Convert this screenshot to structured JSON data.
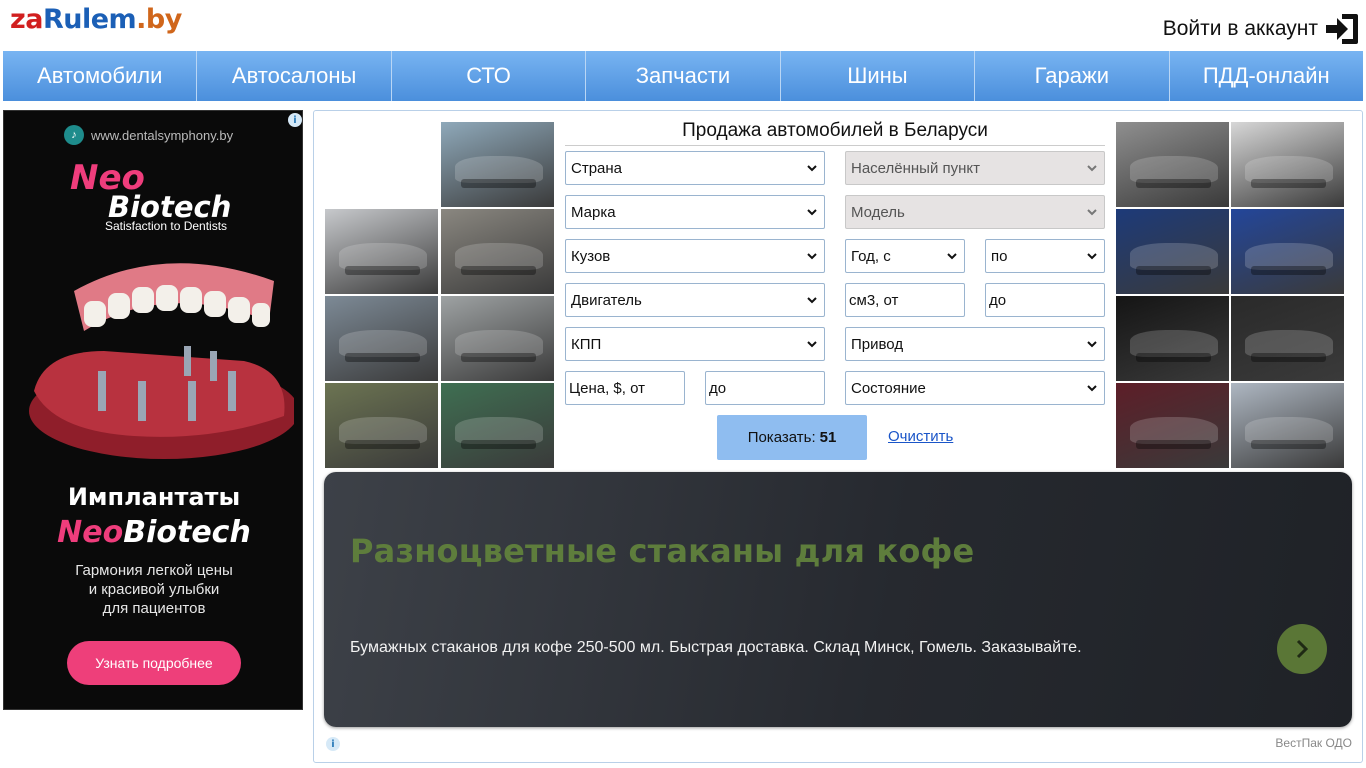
{
  "header": {
    "logo_part1": "za",
    "logo_part2": "Rulem",
    "logo_part3": ".by",
    "login_label": "Войти в аккаунт",
    "login_icon": "sign-in-icon"
  },
  "nav": {
    "items": [
      {
        "label": "Автомобили"
      },
      {
        "label": "Автосалоны"
      },
      {
        "label": "СТО"
      },
      {
        "label": "Запчасти"
      },
      {
        "label": "Шины"
      },
      {
        "label": "Гаражи"
      },
      {
        "label": "ПДД-онлайн"
      }
    ]
  },
  "left_ad": {
    "site": "www.dentalsymphony.by",
    "brand_neo": "Neo",
    "brand_biotech": "Biotech",
    "tagline": "Satisfaction to Dentists",
    "headline": "Имплантаты",
    "headline2_neo": "Neo",
    "headline2_biotech": "Biotech",
    "text_line1": "Гармония легкой цены",
    "text_line2": "и красивой улыбки",
    "text_line3": "для пациентов",
    "button": "Узнать подробнее",
    "info_icon": "i"
  },
  "search": {
    "title": "Продажа автомобилей в Беларуси",
    "country": "Страна",
    "city": "Населённый пункт",
    "brand": "Марка",
    "model": "Модель",
    "body": "Кузов",
    "year_from": "Год, с",
    "year_to": "по",
    "engine": "Двигатель",
    "cc_from": "см3, от",
    "cc_to": "до",
    "gearbox": "КПП",
    "drive": "Привод",
    "price_from": "Цена, $, от",
    "price_to": "до",
    "condition": "Состояние",
    "show_label": "Показать:",
    "show_count": "51",
    "clear_label": "Очистить"
  },
  "photos": {
    "left": [
      {
        "color": "#8fa9ba"
      },
      {
        "color": "#c7c9cc"
      },
      {
        "color": "#8a8780"
      },
      {
        "color": "#7d8a96"
      },
      {
        "color": "#9ea2a3"
      },
      {
        "color": "#6c7452"
      },
      {
        "color": "#3f6f52"
      }
    ],
    "right": [
      {
        "color": "#8f8f8f"
      },
      {
        "color": "#d7d7d7"
      },
      {
        "color": "#1d3a79"
      },
      {
        "color": "#23469a"
      },
      {
        "color": "#151515"
      },
      {
        "color": "#2a2a2a"
      },
      {
        "color": "#5d1e28"
      },
      {
        "color": "#aeb7c2"
      }
    ]
  },
  "coffee_ad": {
    "title": "Разноцветные стаканы для кофе",
    "text": "Бумажных стаканов для кофе 250-500 мл. Быстрая доставка. Склад Минск, Гомель. Заказывайте.",
    "sponsor": "ВестПак ОДО",
    "arrow_icon": "chevron-right-icon"
  }
}
